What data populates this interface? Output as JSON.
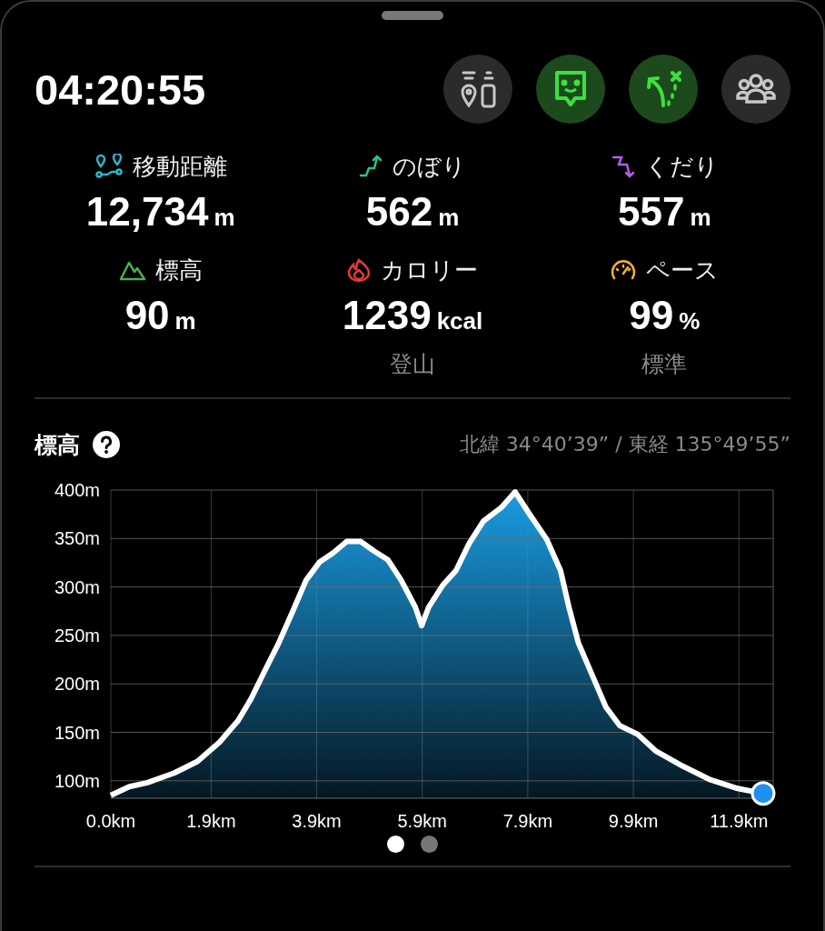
{
  "time": "04:20:55",
  "toolbar": [
    {
      "kind": "markers",
      "on": false
    },
    {
      "kind": "chat",
      "on": true
    },
    {
      "kind": "route",
      "on": true
    },
    {
      "kind": "group",
      "on": false
    }
  ],
  "stats": [
    {
      "kind": "distance",
      "label": "移動距離",
      "value": "12,734",
      "unit": "m"
    },
    {
      "kind": "ascent",
      "label": "のぼり",
      "value": "562",
      "unit": "m"
    },
    {
      "kind": "descent",
      "label": "くだり",
      "value": "557",
      "unit": "m"
    },
    {
      "kind": "elevation",
      "label": "標高",
      "value": "90",
      "unit": "m"
    },
    {
      "kind": "calories",
      "label": "カロリー",
      "value": "1239",
      "unit": "kcal",
      "note": "登山"
    },
    {
      "kind": "pace",
      "label": "ペース",
      "value": "99",
      "unit": "%",
      "note": "標準"
    }
  ],
  "elevation": {
    "title": "標高",
    "coordinates": "北緯 34°40’39” / 東経 135°49’55”",
    "chart_data": {
      "type": "area",
      "grid": true,
      "xlim": [
        0,
        12.55
      ],
      "ylim": [
        82,
        400
      ],
      "xticks": [
        {
          "value": 0,
          "label": "0.0km"
        },
        {
          "value": 1.9,
          "label": "1.9km"
        },
        {
          "value": 3.9,
          "label": "3.9km"
        },
        {
          "value": 5.9,
          "label": "5.9km"
        },
        {
          "value": 7.9,
          "label": "7.9km"
        },
        {
          "value": 9.9,
          "label": "9.9km"
        },
        {
          "value": 11.9,
          "label": "11.9km"
        }
      ],
      "yticks": [
        {
          "value": 100,
          "label": "100m"
        },
        {
          "value": 150,
          "label": "150m"
        },
        {
          "value": 200,
          "label": "200m"
        },
        {
          "value": 250,
          "label": "250m"
        },
        {
          "value": 300,
          "label": "300m"
        },
        {
          "value": 350,
          "label": "350m"
        },
        {
          "value": 400,
          "label": "400m"
        }
      ],
      "x": [
        0,
        0.35,
        0.69,
        1.2,
        1.64,
        2.06,
        2.41,
        2.66,
        2.93,
        3.18,
        3.44,
        3.7,
        3.96,
        4.21,
        4.47,
        4.73,
        4.99,
        5.25,
        5.5,
        5.77,
        5.89,
        6.02,
        6.29,
        6.54,
        6.79,
        7.06,
        7.4,
        7.66,
        7.91,
        8.26,
        8.52,
        8.68,
        8.86,
        9.12,
        9.38,
        9.64,
        9.98,
        10.32,
        10.84,
        11.36,
        11.88,
        12.36
      ],
      "series": [
        {
          "color": "#1a9be0",
          "values": [
            85,
            94,
            98,
            108,
            120,
            140,
            162,
            185,
            215,
            242,
            274,
            307,
            326,
            335,
            347,
            347,
            337,
            328,
            307,
            279,
            260,
            279,
            302,
            317,
            345,
            368,
            382,
            398,
            377,
            349,
            317,
            279,
            242,
            209,
            176,
            157,
            148,
            131,
            115,
            101,
            92,
            87
          ]
        }
      ]
    }
  },
  "pager": [
    {
      "selected": true
    },
    {
      "selected": false
    }
  ]
}
